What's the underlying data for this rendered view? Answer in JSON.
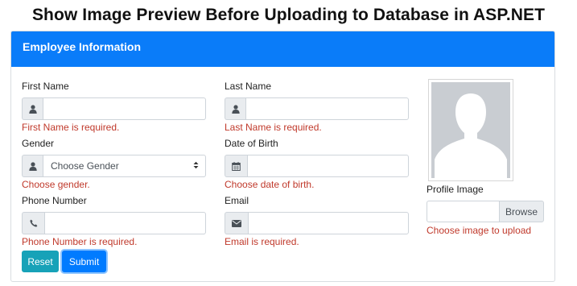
{
  "page": {
    "title": "Show Image Preview Before Uploading to Database in ASP.NET"
  },
  "card": {
    "header": "Employee Information"
  },
  "form": {
    "first_name": {
      "label": "First Name",
      "value": "",
      "error": "First Name is required."
    },
    "last_name": {
      "label": "Last Name",
      "value": "",
      "error": "Last Name is required."
    },
    "gender": {
      "label": "Gender",
      "selected": "Choose Gender",
      "error": "Choose gender."
    },
    "dob": {
      "label": "Date of Birth",
      "value": "",
      "error": "Choose date of birth."
    },
    "phone": {
      "label": "Phone Number",
      "value": "",
      "error": "Phone Number is required."
    },
    "email": {
      "label": "Email",
      "value": "",
      "error": "Email is required."
    },
    "profile_image": {
      "label": "Profile Image",
      "browse_label": "Browse",
      "error": "Choose image to upload"
    }
  },
  "buttons": {
    "reset": "Reset",
    "submit": "Submit"
  },
  "icons": {
    "first_name": "user-icon",
    "last_name": "user-icon",
    "gender": "user-icon",
    "dob": "calendar-icon",
    "phone": "phone-icon",
    "email": "envelope-icon"
  },
  "colors": {
    "header": "#0a7cf9",
    "error": "#c0392b",
    "reset": "#17a2b8",
    "submit": "#007bff"
  }
}
